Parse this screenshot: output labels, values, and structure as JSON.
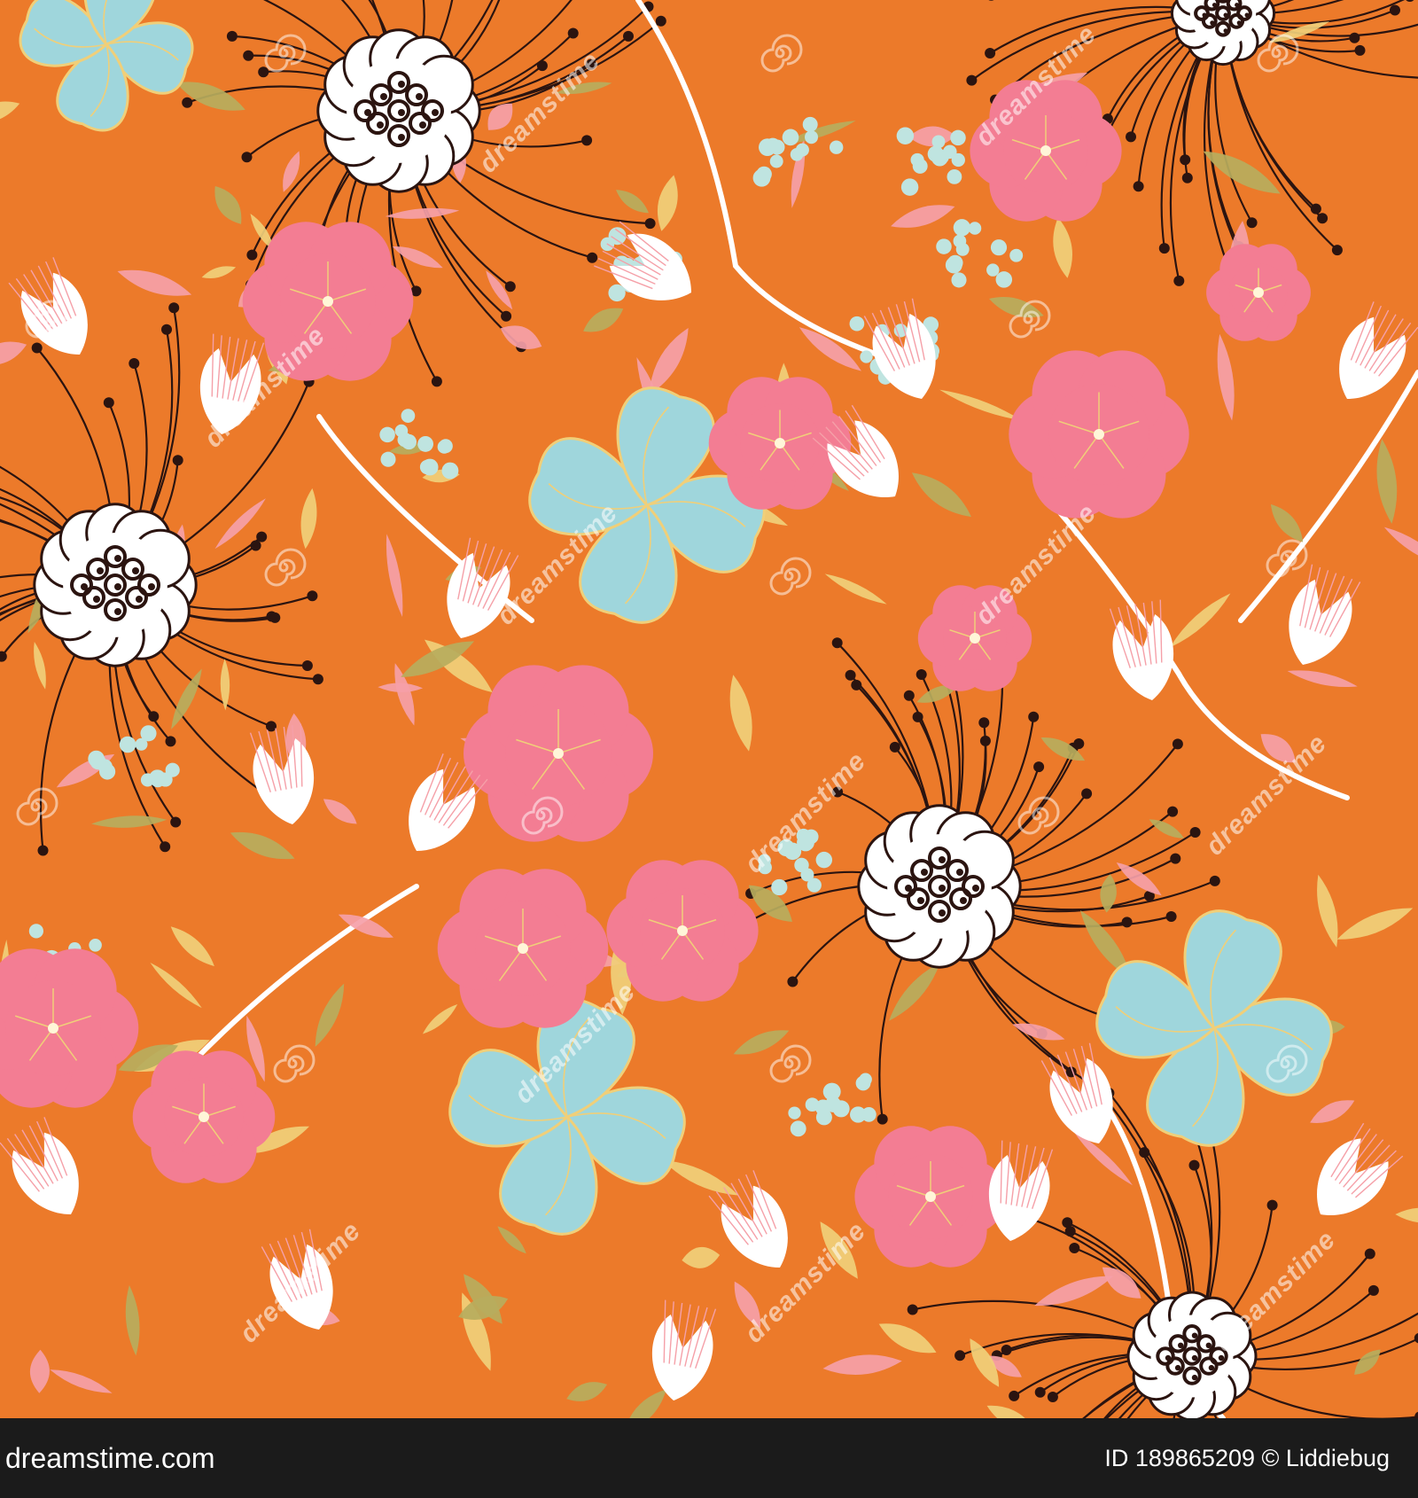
{
  "watermark": {
    "text": "dreamstime"
  },
  "footer": {
    "brand": "dreamstime.com",
    "credit": "ID 189865209 © Liddiebug"
  },
  "colors": {
    "background": "#ec7a2a",
    "pink_flower": "#f37d93",
    "blue_flower": "#9fd6dc",
    "white_flower": "#ffffff",
    "flower_ink": "#2b1410",
    "leaf_yellow": "#f0cf79",
    "leaf_green": "#b7ad5d",
    "leaf_pink": "#f5a0a8",
    "berry": "#bfe4e0"
  },
  "icons": [
    "swirl-watermark-icon"
  ]
}
